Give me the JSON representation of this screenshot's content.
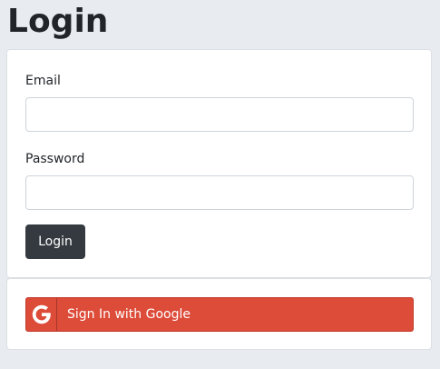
{
  "page": {
    "title": "Login"
  },
  "login_form": {
    "email_label": "Email",
    "email_value": "",
    "email_placeholder": "",
    "password_label": "Password",
    "password_value": "",
    "password_placeholder": "",
    "login_button_label": "Login"
  },
  "google_signin": {
    "button_label": "Sign In with Google",
    "icon": "google-icon"
  },
  "colors": {
    "background": "#e8ebef",
    "card": "#ffffff",
    "login_button": "#343a40",
    "google_button": "#dd4b39"
  }
}
